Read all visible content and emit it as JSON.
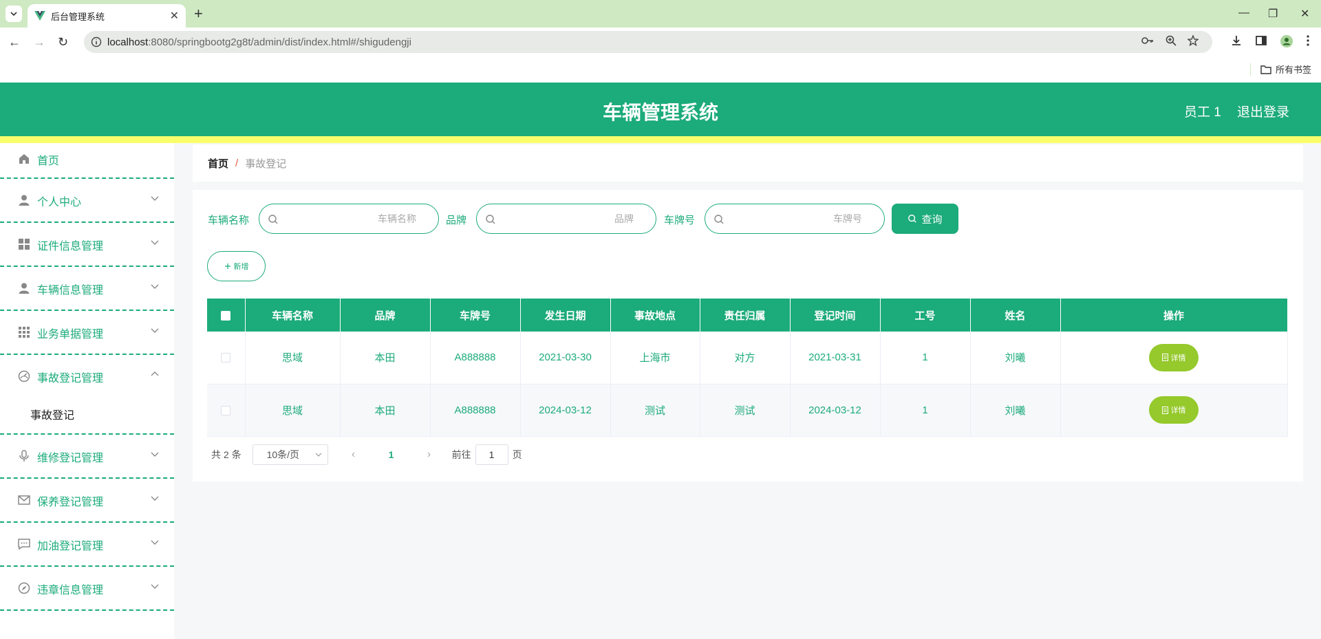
{
  "browser": {
    "tab_title": "后台管理系统",
    "url_host": "localhost",
    "url_rest": ":8080/springbootg2g8t/admin/dist/index.html#/shigudengji",
    "bookmarks_label": "所有书签"
  },
  "header": {
    "title": "车辆管理系统",
    "user": "员工 1",
    "logout": "退出登录"
  },
  "sidebar": {
    "items": [
      {
        "label": "首页",
        "icon": "home-icon"
      },
      {
        "label": "个人中心",
        "icon": "user-icon"
      },
      {
        "label": "证件信息管理",
        "icon": "grid-icon"
      },
      {
        "label": "车辆信息管理",
        "icon": "user-icon"
      },
      {
        "label": "业务单据管理",
        "icon": "apps-icon"
      },
      {
        "label": "事故登记管理",
        "icon": "gauge-icon"
      },
      {
        "label": "维修登记管理",
        "icon": "mic-icon"
      },
      {
        "label": "保养登记管理",
        "icon": "mail-icon"
      },
      {
        "label": "加油登记管理",
        "icon": "chat-icon"
      },
      {
        "label": "违章信息管理",
        "icon": "compass-icon"
      }
    ],
    "sub_item": "事故登记"
  },
  "breadcrumb": {
    "home": "首页",
    "sep": "/",
    "current": "事故登记"
  },
  "search": {
    "vehicle_label": "车辆名称",
    "vehicle_placeholder": "车辆名称",
    "brand_label": "品牌",
    "brand_placeholder": "品牌",
    "plate_label": "车牌号",
    "plate_placeholder": "车牌号",
    "query_button": "查询",
    "add_button": "新增"
  },
  "table": {
    "headers": [
      "车辆名称",
      "品牌",
      "车牌号",
      "发生日期",
      "事故地点",
      "责任归属",
      "登记时间",
      "工号",
      "姓名",
      "操作"
    ],
    "rows": [
      {
        "cells": [
          "思域",
          "本田",
          "A888888",
          "2021-03-30",
          "上海市",
          "对方",
          "2021-03-31",
          "1",
          "刘曦"
        ],
        "action": "详情"
      },
      {
        "cells": [
          "思域",
          "本田",
          "A888888",
          "2024-03-12",
          "测试",
          "测试",
          "2024-03-12",
          "1",
          "刘曦"
        ],
        "action": "详情"
      }
    ]
  },
  "pagination": {
    "total": "共 2 条",
    "page_size": "10条/页",
    "current_page": "1",
    "goto_label": "前往",
    "goto_value": "1",
    "page_suffix": "页"
  },
  "colors": {
    "primary": "#1cab7a",
    "accent_bar": "#f8ff6a",
    "detail_button": "#95c92c"
  }
}
